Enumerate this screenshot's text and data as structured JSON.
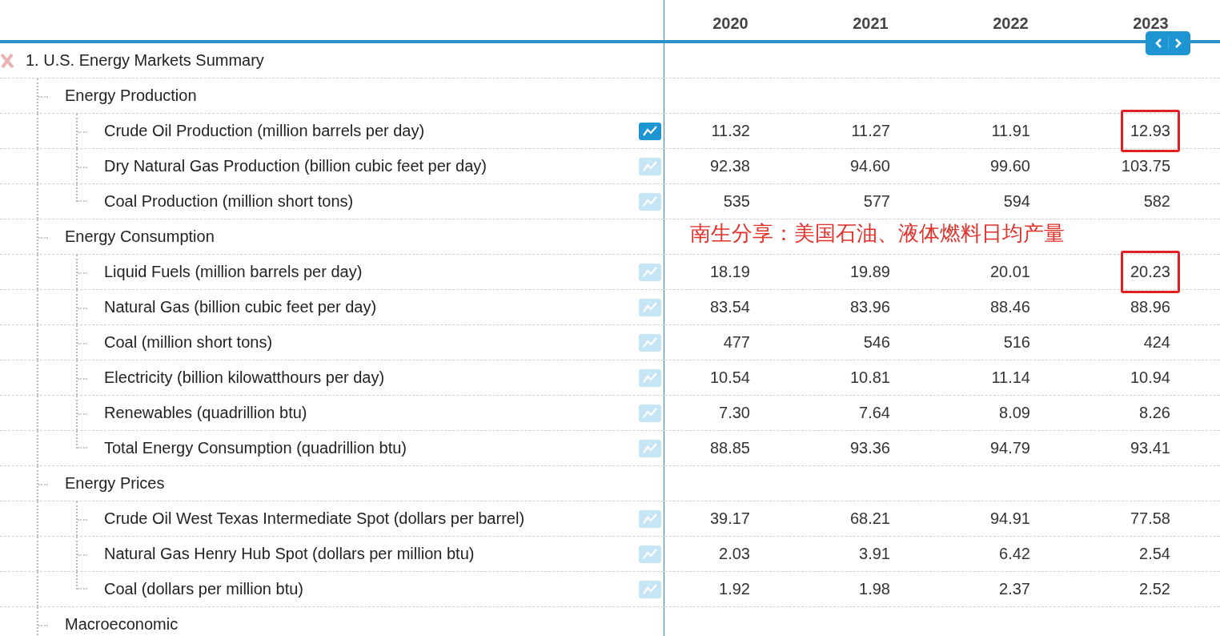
{
  "header": {
    "years": [
      "2020",
      "2021",
      "2022",
      "2023"
    ]
  },
  "tree": {
    "label": "1. U.S. Energy Markets Summary",
    "expanded": true,
    "children": [
      {
        "label": "Energy Production",
        "children": [
          {
            "label": "Crude Oil Production (million barrels per day)",
            "chart_selected": true,
            "values": [
              {
                "text": "11.32",
                "highlighted": false
              },
              {
                "text": "11.27",
                "highlighted": false
              },
              {
                "text": "11.91",
                "highlighted": false
              },
              {
                "text": "12.93",
                "highlighted": true
              }
            ]
          },
          {
            "label": "Dry Natural Gas Production (billion cubic feet per day)",
            "chart_selected": false,
            "values": [
              {
                "text": "92.38",
                "highlighted": false
              },
              {
                "text": "94.60",
                "highlighted": false
              },
              {
                "text": "99.60",
                "highlighted": false
              },
              {
                "text": "103.75",
                "highlighted": false
              }
            ]
          },
          {
            "label": "Coal Production (million short tons)",
            "chart_selected": false,
            "values": [
              {
                "text": "535",
                "highlighted": false
              },
              {
                "text": "577",
                "highlighted": false
              },
              {
                "text": "594",
                "highlighted": false
              },
              {
                "text": "582",
                "highlighted": false
              }
            ]
          }
        ]
      },
      {
        "label": "Energy Consumption",
        "annotation": "南生分享：美国石油、液体燃料日均产量",
        "children": [
          {
            "label": "Liquid Fuels (million barrels per day)",
            "chart_selected": false,
            "values": [
              {
                "text": "18.19",
                "highlighted": false
              },
              {
                "text": "19.89",
                "highlighted": false
              },
              {
                "text": "20.01",
                "highlighted": false
              },
              {
                "text": "20.23",
                "highlighted": true
              }
            ]
          },
          {
            "label": "Natural Gas (billion cubic feet per day)",
            "chart_selected": false,
            "values": [
              {
                "text": "83.54",
                "highlighted": false
              },
              {
                "text": "83.96",
                "highlighted": false
              },
              {
                "text": "88.46",
                "highlighted": false
              },
              {
                "text": "88.96",
                "highlighted": false
              }
            ]
          },
          {
            "label": "Coal (million short tons)",
            "chart_selected": false,
            "values": [
              {
                "text": "477",
                "highlighted": false
              },
              {
                "text": "546",
                "highlighted": false
              },
              {
                "text": "516",
                "highlighted": false
              },
              {
                "text": "424",
                "highlighted": false
              }
            ]
          },
          {
            "label": "Electricity (billion kilowatthours per day)",
            "chart_selected": false,
            "values": [
              {
                "text": "10.54",
                "highlighted": false
              },
              {
                "text": "10.81",
                "highlighted": false
              },
              {
                "text": "11.14",
                "highlighted": false
              },
              {
                "text": "10.94",
                "highlighted": false
              }
            ]
          },
          {
            "label": "Renewables (quadrillion btu)",
            "chart_selected": false,
            "values": [
              {
                "text": "7.30",
                "highlighted": false
              },
              {
                "text": "7.64",
                "highlighted": false
              },
              {
                "text": "8.09",
                "highlighted": false
              },
              {
                "text": "8.26",
                "highlighted": false
              }
            ]
          },
          {
            "label": "Total Energy Consumption (quadrillion btu)",
            "chart_selected": false,
            "values": [
              {
                "text": "88.85",
                "highlighted": false
              },
              {
                "text": "93.36",
                "highlighted": false
              },
              {
                "text": "94.79",
                "highlighted": false
              },
              {
                "text": "93.41",
                "highlighted": false
              }
            ]
          }
        ]
      },
      {
        "label": "Energy Prices",
        "children": [
          {
            "label": "Crude Oil West Texas Intermediate Spot (dollars per barrel)",
            "chart_selected": false,
            "values": [
              {
                "text": "39.17",
                "highlighted": false
              },
              {
                "text": "68.21",
                "highlighted": false
              },
              {
                "text": "94.91",
                "highlighted": false
              },
              {
                "text": "77.58",
                "highlighted": false
              }
            ]
          },
          {
            "label": "Natural Gas Henry Hub Spot (dollars per million btu)",
            "chart_selected": false,
            "values": [
              {
                "text": "2.03",
                "highlighted": false
              },
              {
                "text": "3.91",
                "highlighted": false
              },
              {
                "text": "6.42",
                "highlighted": false
              },
              {
                "text": "2.54",
                "highlighted": false
              }
            ]
          },
          {
            "label": "Coal (dollars per million btu)",
            "chart_selected": false,
            "values": [
              {
                "text": "1.92",
                "highlighted": false
              },
              {
                "text": "1.98",
                "highlighted": false
              },
              {
                "text": "2.37",
                "highlighted": false
              },
              {
                "text": "2.52",
                "highlighted": false
              }
            ]
          }
        ]
      },
      {
        "label": "Macroeconomic"
      }
    ]
  }
}
